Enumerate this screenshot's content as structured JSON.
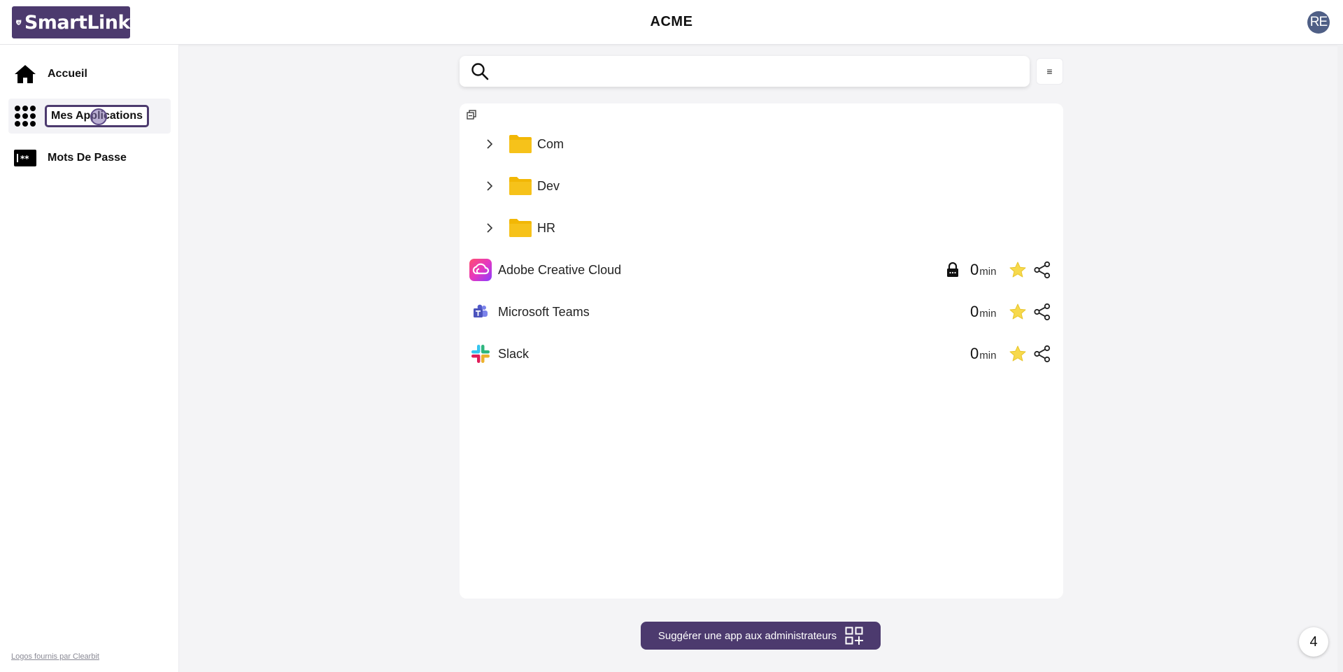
{
  "brand": {
    "name": "SmartLink",
    "color": "#4c3a6e"
  },
  "header": {
    "title": "ACME",
    "avatar_initials": "RE"
  },
  "sidebar": {
    "items": [
      {
        "label": "Accueil",
        "icon": "home-icon"
      },
      {
        "label": "Mes Applications",
        "icon": "grid-dots-icon",
        "active": true
      },
      {
        "label": "Mots De Passe",
        "icon": "password-icon"
      }
    ],
    "footer": "Logos fournis par Clearbit"
  },
  "search": {
    "value": "",
    "placeholder": ""
  },
  "menu_button": {
    "label": "≡"
  },
  "tree": {
    "folders": [
      {
        "label": "Com"
      },
      {
        "label": "Dev"
      },
      {
        "label": "HR"
      }
    ],
    "apps": [
      {
        "label": "Adobe Creative Cloud",
        "time": "0",
        "unit": "min",
        "locked": true
      },
      {
        "label": "Microsoft Teams",
        "time": "0",
        "unit": "min",
        "locked": false
      },
      {
        "label": "Slack",
        "time": "0",
        "unit": "min",
        "locked": false
      }
    ]
  },
  "suggest": {
    "label": "Suggérer une app aux administrateurs"
  },
  "notification_badge": {
    "count": "4"
  }
}
